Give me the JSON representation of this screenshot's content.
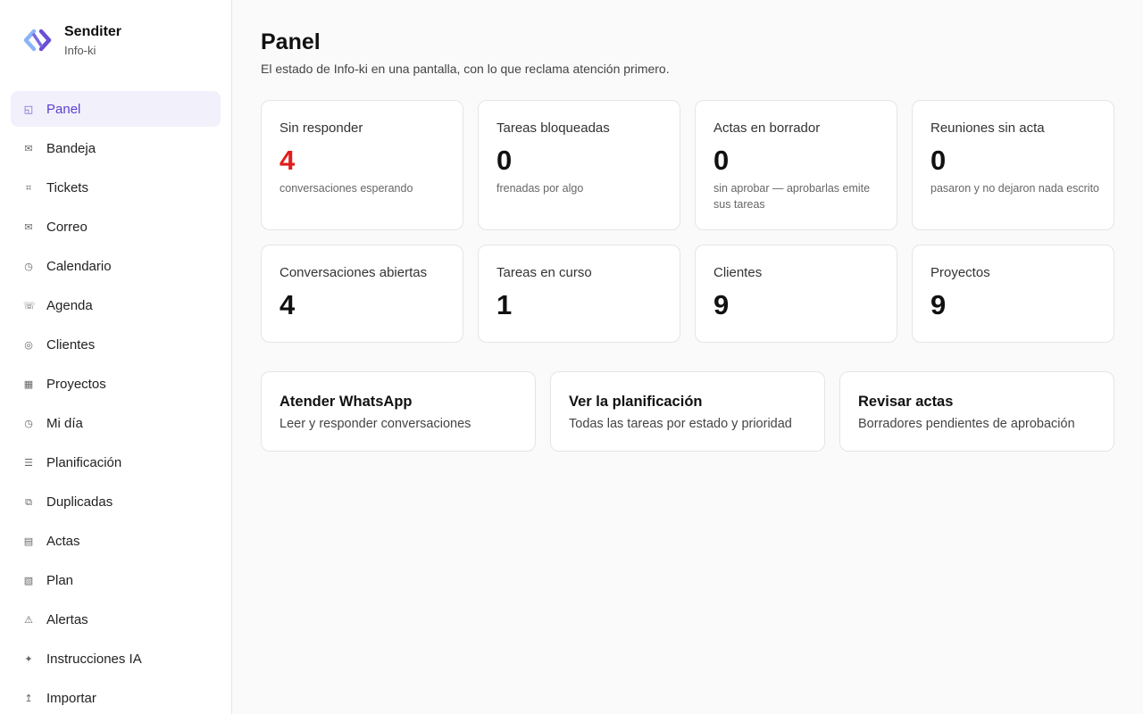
{
  "brand": {
    "name": "Senditer",
    "subtitle": "Info-ki"
  },
  "sidebar": {
    "items": [
      {
        "label": "Panel",
        "icon": "◱",
        "active": true,
        "name": "panel"
      },
      {
        "label": "Bandeja",
        "icon": "✉",
        "active": false,
        "name": "bandeja"
      },
      {
        "label": "Tickets",
        "icon": "⌗",
        "active": false,
        "name": "tickets"
      },
      {
        "label": "Correo",
        "icon": "✉",
        "active": false,
        "name": "correo"
      },
      {
        "label": "Calendario",
        "icon": "◷",
        "active": false,
        "name": "calendario"
      },
      {
        "label": "Agenda",
        "icon": "☏",
        "active": false,
        "name": "agenda"
      },
      {
        "label": "Clientes",
        "icon": "◎",
        "active": false,
        "name": "clientes"
      },
      {
        "label": "Proyectos",
        "icon": "▦",
        "active": false,
        "name": "proyectos"
      },
      {
        "label": "Mi día",
        "icon": "◷",
        "active": false,
        "name": "mi-dia"
      },
      {
        "label": "Planificación",
        "icon": "☰",
        "active": false,
        "name": "planificacion"
      },
      {
        "label": "Duplicadas",
        "icon": "⧉",
        "active": false,
        "name": "duplicadas"
      },
      {
        "label": "Actas",
        "icon": "▤",
        "active": false,
        "name": "actas"
      },
      {
        "label": "Plan",
        "icon": "▧",
        "active": false,
        "name": "plan"
      },
      {
        "label": "Alertas",
        "icon": "⚠",
        "active": false,
        "name": "alertas"
      },
      {
        "label": "Instrucciones IA",
        "icon": "✦",
        "active": false,
        "name": "instrucciones-ia"
      },
      {
        "label": "Importar",
        "icon": "↥",
        "active": false,
        "name": "importar"
      }
    ]
  },
  "header": {
    "title": "Panel",
    "subtitle": "El estado de Info-ki en una pantalla, con lo que reclama atención primero."
  },
  "stats": [
    {
      "title": "Sin responder",
      "value": "4",
      "desc": "conversaciones esperando",
      "alert": true
    },
    {
      "title": "Tareas bloqueadas",
      "value": "0",
      "desc": "frenadas por algo"
    },
    {
      "title": "Actas en borrador",
      "value": "0",
      "desc": "sin aprobar — aprobarlas emite sus tareas"
    },
    {
      "title": "Reuniones sin acta",
      "value": "0",
      "desc": "pasaron y no dejaron nada escrito"
    },
    {
      "title": "Conversaciones abiertas",
      "value": "4",
      "desc": ""
    },
    {
      "title": "Tareas en curso",
      "value": "1",
      "desc": ""
    },
    {
      "title": "Clientes",
      "value": "9",
      "desc": ""
    },
    {
      "title": "Proyectos",
      "value": "9",
      "desc": ""
    }
  ],
  "actions": [
    {
      "title": "Atender WhatsApp",
      "desc": "Leer y responder conversaciones"
    },
    {
      "title": "Ver la planificación",
      "desc": "Todas las tareas por estado y prioridad"
    },
    {
      "title": "Revisar actas",
      "desc": "Borradores pendientes de aprobación"
    }
  ],
  "colors": {
    "accent": "#5b3fd0",
    "alert": "#e11d1d",
    "logo_light": "#8ab4f8",
    "logo_dark": "#6a4fd6"
  }
}
